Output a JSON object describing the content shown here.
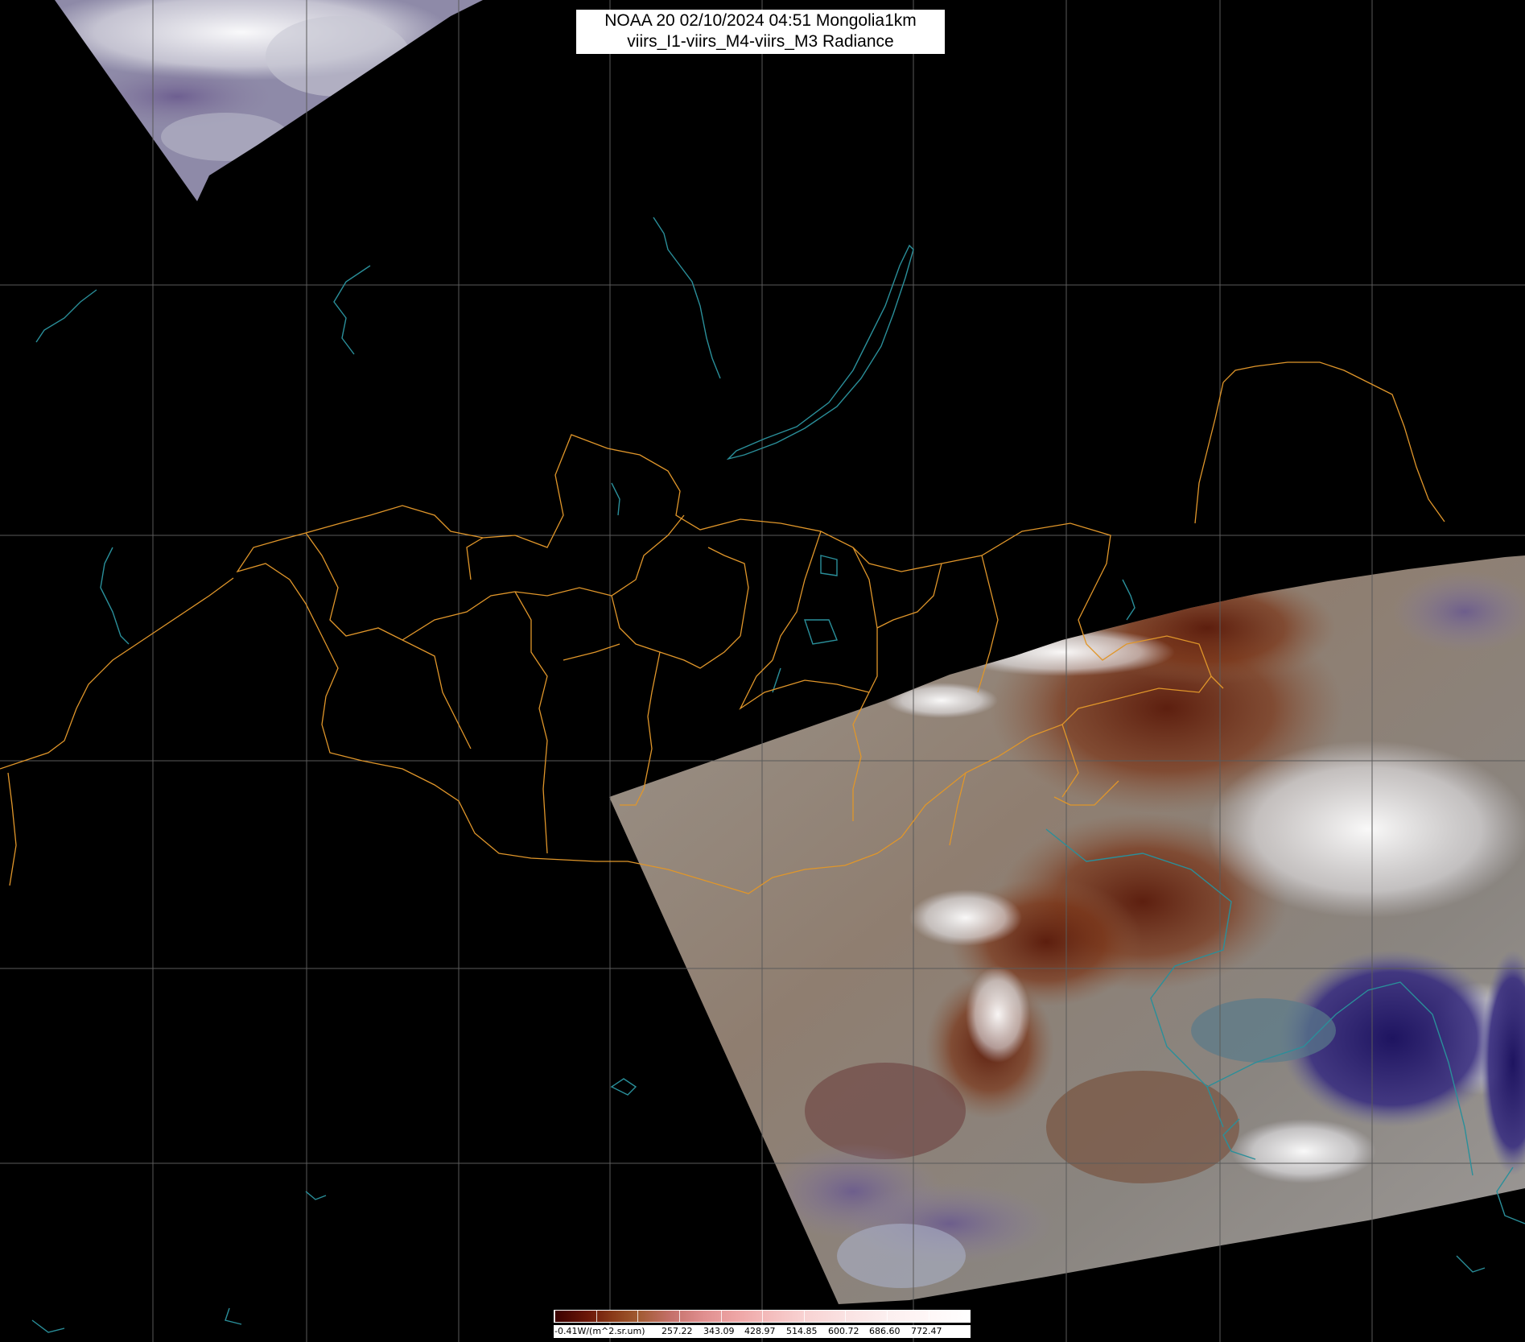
{
  "title": {
    "line1": "NOAA 20 02/10/2024 04:51 Mongolia1km",
    "line2": "viirs_I1-viirs_M4-viirs_M3 Radiance"
  },
  "colorbar": {
    "unit_label": "-0.41W/(m^2.sr.um)",
    "tick_labels": [
      "257.22",
      "343.09",
      "428.97",
      "514.85",
      "600.72",
      "686.60",
      "772.47"
    ]
  },
  "colors": {
    "background": "#000000",
    "graticule": "#5a5a5a",
    "province_border": "#e0962a",
    "coastline": "#2a8f9a",
    "land": "#9a9188",
    "land_dark": "#6e2a12",
    "snow": "#f2f2f2",
    "sea": "#2a1f6e"
  },
  "map": {
    "region": "Mongolia1km",
    "layers": [
      "graticule",
      "coastlines",
      "province-borders",
      "satellite-swath"
    ]
  }
}
